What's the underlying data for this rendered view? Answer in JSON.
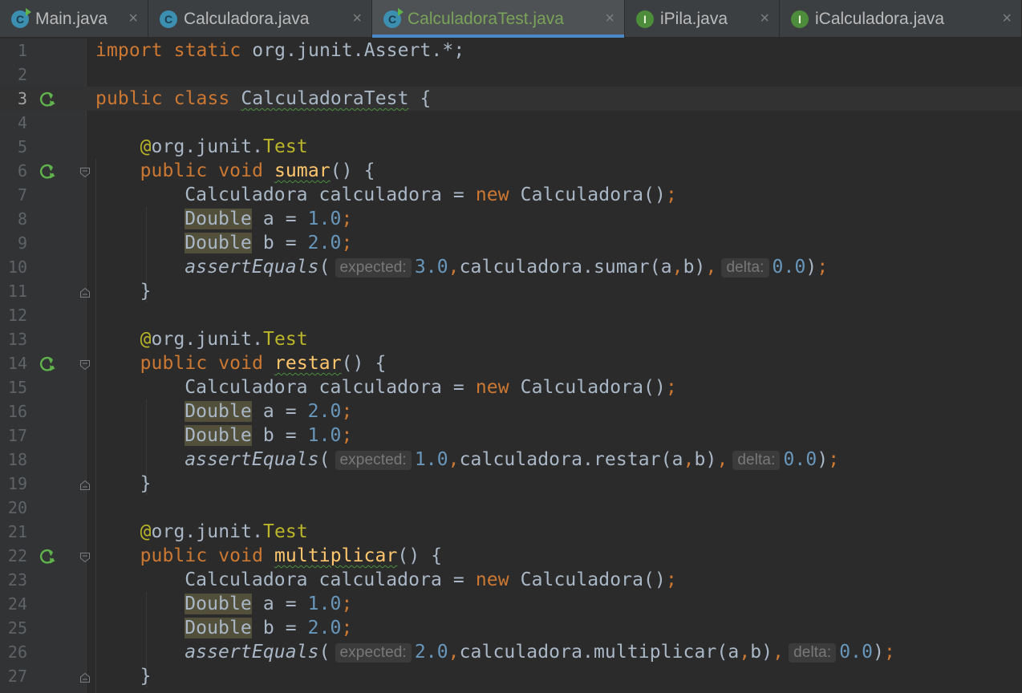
{
  "tabs": [
    {
      "label": "Main.java",
      "icon": "class-run-icon",
      "active": false
    },
    {
      "label": "Calculadora.java",
      "icon": "class-icon",
      "active": false
    },
    {
      "label": "CalculadoraTest.java",
      "icon": "class-run-icon",
      "active": true
    },
    {
      "label": "iPila.java",
      "icon": "interface-icon",
      "active": false
    },
    {
      "label": "iCalculadora.java",
      "icon": "interface-icon",
      "active": false
    }
  ],
  "icons": {
    "class_letter": "C",
    "interface_letter": "I",
    "close": "×"
  },
  "code": {
    "import_line": {
      "kw1": "import",
      "kw2": "static",
      "rest": " org.junit.Assert.*;"
    },
    "class_line": {
      "kw1": "public",
      "kw2": "class",
      "name": "CalculadoraTest",
      "brace": " {"
    },
    "annotation": {
      "at": "@",
      "pkg": "org.junit.",
      "name": "Test"
    },
    "decl": {
      "kw1": "public",
      "kw2": "void",
      "paren": "() {"
    },
    "new_line": {
      "type": "Calculadora",
      "var": " calculadora = ",
      "kw": "new",
      "rest": " Calculadora();"
    },
    "double_type": "Double",
    "assign_a": " a = ",
    "assign_b": " b = ",
    "semi": ";",
    "assert_fn": "assertEquals",
    "open_paren": "(",
    "hint_expected": "expected:",
    "hint_delta": "delta:",
    "call_prefix": ",calculadora.",
    "args": "(a,b),",
    "close": ");",
    "close_brace": "}",
    "methods": [
      {
        "name": "sumar",
        "a": "1.0",
        "b": "2.0",
        "expected": "3.0",
        "delta": "0.0"
      },
      {
        "name": "restar",
        "a": "2.0",
        "b": "1.0",
        "expected": "1.0",
        "delta": "0.0"
      },
      {
        "name": "multiplicar",
        "a": "1.0",
        "b": "2.0",
        "expected": "2.0",
        "delta": "0.0"
      }
    ]
  },
  "line_numbers": [
    "1",
    "2",
    "3",
    "4",
    "5",
    "6",
    "7",
    "8",
    "9",
    "10",
    "11",
    "12",
    "13",
    "14",
    "15",
    "16",
    "17",
    "18",
    "19",
    "20",
    "21",
    "22",
    "23",
    "24",
    "25",
    "26",
    "27"
  ],
  "colors": {
    "background": "#2b2b2b",
    "gutter": "#313335",
    "keyword": "#cc7832",
    "number": "#6897bb",
    "annotation": "#bbb529",
    "method": "#ffc66d",
    "text": "#a9b7c6",
    "active_tab_underline": "#4a88c7",
    "run_icon": "#5fb24c"
  }
}
